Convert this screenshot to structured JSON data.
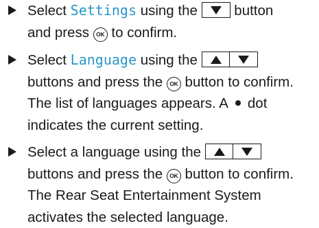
{
  "steps": [
    {
      "lines": [
        {
          "pre": "Select ",
          "term": "Settings",
          "mid": " using the ",
          "post": " button"
        },
        {
          "pre": "and press ",
          "ok": "OK",
          "post": " to confirm."
        }
      ]
    },
    {
      "lines": [
        {
          "pre": "Select ",
          "term": "Language",
          "mid": " using the "
        },
        {
          "pre": "buttons and press the ",
          "ok": "OK",
          "post": " button to confirm."
        },
        {
          "text": "The list of languages appears. A"
        },
        {
          "text": "indicates the current setting."
        }
      ],
      "dot_text": "dot"
    },
    {
      "lines": [
        {
          "pre": "Select a language using the "
        },
        {
          "pre": "buttons and press the ",
          "ok": "OK",
          "post": " button to confirm."
        },
        {
          "text": "The Rear Seat Entertainment System"
        },
        {
          "text": "activates the selected language."
        }
      ]
    }
  ],
  "icons": {
    "bullet": "triangle-bullet-icon",
    "up": "up-arrow-button",
    "down": "down-arrow-button",
    "ok": "ok-button"
  },
  "colors": {
    "ui_term": "#2a97c8",
    "text": "#1a1a1a"
  }
}
